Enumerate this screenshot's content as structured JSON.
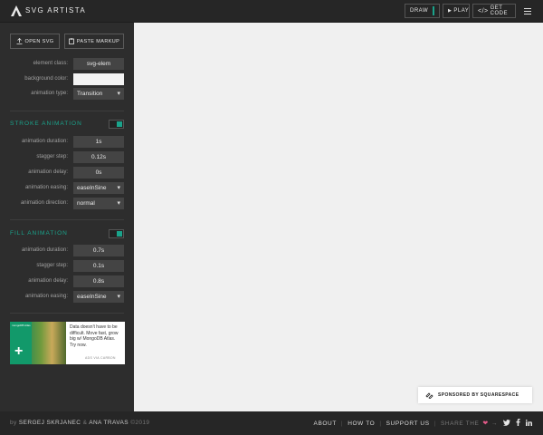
{
  "header": {
    "brand": "SVG ARTISTA",
    "draw_label": "DRAW",
    "play_label": "PLAY",
    "get_code_label": "GET CODE"
  },
  "sidebar": {
    "open_svg_label": "OPEN SVG",
    "paste_markup_label": "PASTE MARKUP",
    "general": [
      {
        "label": "element class:",
        "value": "svg-elem"
      },
      {
        "label": "background color:",
        "value": ""
      },
      {
        "label": "animation type:",
        "value": "Transition"
      }
    ],
    "stroke": {
      "title": "STROKE ANIMATION",
      "enabled": true,
      "rows": [
        {
          "label": "animation duration:",
          "value": "1s"
        },
        {
          "label": "stagger step:",
          "value": "0.12s"
        },
        {
          "label": "animation delay:",
          "value": "0s"
        },
        {
          "label": "animation easing:",
          "value": "easeInSine"
        },
        {
          "label": "animation direction:",
          "value": "normal"
        }
      ]
    },
    "fill": {
      "title": "FILL ANIMATION",
      "enabled": true,
      "rows": [
        {
          "label": "animation duration:",
          "value": "0.7s"
        },
        {
          "label": "stagger step:",
          "value": "0.1s"
        },
        {
          "label": "animation delay:",
          "value": "0.8s"
        },
        {
          "label": "animation easing:",
          "value": "easeInSine"
        }
      ]
    },
    "ad": {
      "tag": "mongoDB Atlas",
      "text": "Data doesn't have to be difficult. Move fast, grow big w/ MongoDB Atlas. Try now.",
      "via": "ADS VIA CARBON"
    }
  },
  "canvas": {
    "sponsor_label": "SPONSORED BY SQUARESPACE"
  },
  "footer": {
    "by": "by",
    "author1": "SERGEJ SKRJANEC",
    "amp": "&",
    "author2": "ANA TRAVAS",
    "year": "©2019",
    "links": [
      "ABOUT",
      "HOW TO",
      "SUPPORT US"
    ],
    "share": "SHARE THE",
    "arrow": "→"
  },
  "colors": {
    "accent": "#1aa38b",
    "sidebar_bg": "#2d2d2d",
    "canvas_bg": "#f0f0f0"
  }
}
